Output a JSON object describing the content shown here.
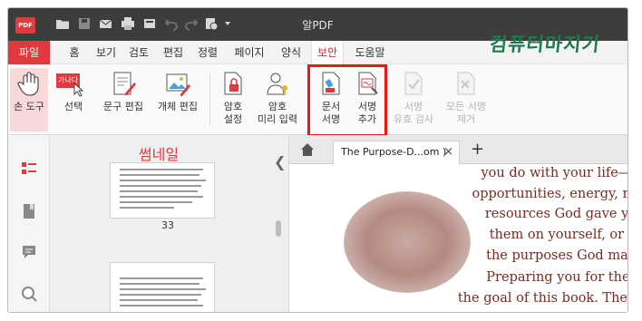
{
  "app": {
    "logo_text": "PDF",
    "title": "알PDF"
  },
  "annotation": {
    "handwritten_text": "컴퓨터마지기"
  },
  "menu": {
    "items": [
      "파일",
      "홈",
      "보기",
      "검토",
      "편집",
      "정렬",
      "페이지",
      "양식",
      "보안",
      "도움말"
    ],
    "active": "보안"
  },
  "ribbon": {
    "hand_tool": "손 도구",
    "select": "선택",
    "text_edit": "문구 편집",
    "object_edit": "개체 편집",
    "password_setting_1": "암호",
    "password_setting_2": "설정",
    "password_input_1": "암호",
    "password_input_2": "미리 입력",
    "doc_sign_1": "문서",
    "doc_sign_2": "서명",
    "add_sign_1": "서명",
    "add_sign_2": "추가",
    "verify_sign_1": "서명",
    "verify_sign_2": "유효 검사",
    "remove_sign_1": "모든 서명",
    "remove_sign_2": "제거",
    "select_badge": "가나다"
  },
  "thumbnails": {
    "title": "썸네일",
    "page_number": "33"
  },
  "tabs": {
    "doc_tab": "The Purpose-D...om )",
    "close": "×",
    "add": "+"
  },
  "document": {
    "lines": [
      "you do with your life—all th",
      "opportunities, energy, re",
      "resources God gave yo",
      "them on yourself, or d",
      "the purposes God mad",
      "Preparing you for thes",
      "the goal of this book. The f"
    ]
  },
  "colors": {
    "brand": "#e03a3e",
    "highlight": "#e31b1b",
    "annotation": "#1f7a4d"
  }
}
